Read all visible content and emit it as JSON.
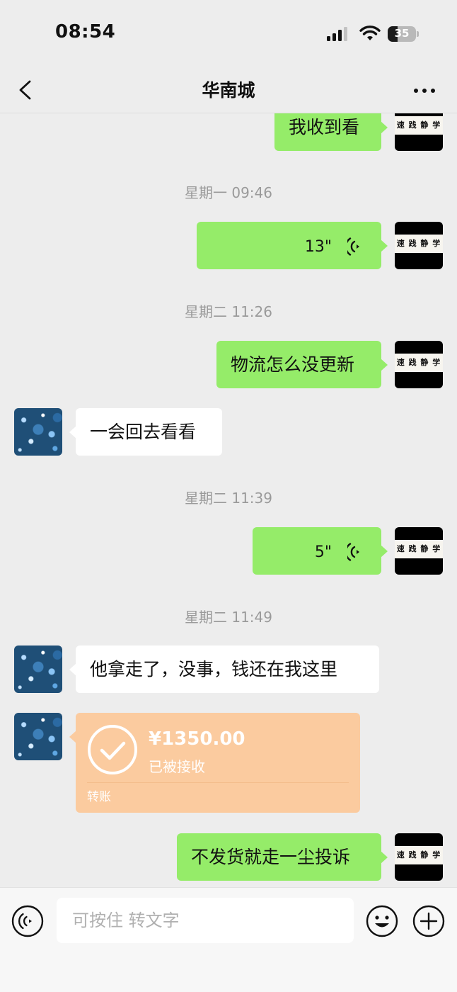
{
  "status_bar": {
    "time": "08:54",
    "battery_level": "35",
    "battery_fraction": 0.35
  },
  "nav": {
    "title": "华南城",
    "back_icon": "chevron-left-icon",
    "more_icon": "more-dots-icon"
  },
  "my_avatar_text": "速 践 静 学",
  "messages": [
    {
      "type": "text",
      "sender": "me",
      "text": "我收到看"
    },
    {
      "type": "timestamp",
      "text": "星期一 09:46"
    },
    {
      "type": "voice",
      "sender": "me",
      "duration": "13\""
    },
    {
      "type": "timestamp",
      "text": "星期二 11:26"
    },
    {
      "type": "text",
      "sender": "me",
      "text": "物流怎么没更新"
    },
    {
      "type": "text",
      "sender": "other",
      "text": "一会回去看看"
    },
    {
      "type": "timestamp",
      "text": "星期二 11:39"
    },
    {
      "type": "voice",
      "sender": "me",
      "duration": "5\""
    },
    {
      "type": "timestamp",
      "text": "星期二 11:49"
    },
    {
      "type": "text",
      "sender": "other",
      "text": "他拿走了，没事，钱还在我这里"
    },
    {
      "type": "transfer",
      "sender": "other",
      "amount": "¥1350.00",
      "status": "已被接收",
      "label": "转账"
    },
    {
      "type": "text",
      "sender": "me",
      "text": "不发货就走一尘投诉"
    }
  ],
  "input_bar": {
    "placeholder": "可按住 转文字",
    "voice_icon": "voice-mode-icon",
    "emoji_icon": "emoji-icon",
    "plus_icon": "plus-icon"
  },
  "colors": {
    "background": "#ededed",
    "my_bubble": "#95ec69",
    "other_bubble": "#ffffff",
    "transfer_card": "#fbcb9f",
    "timestamp_text": "#9a9a9a"
  }
}
